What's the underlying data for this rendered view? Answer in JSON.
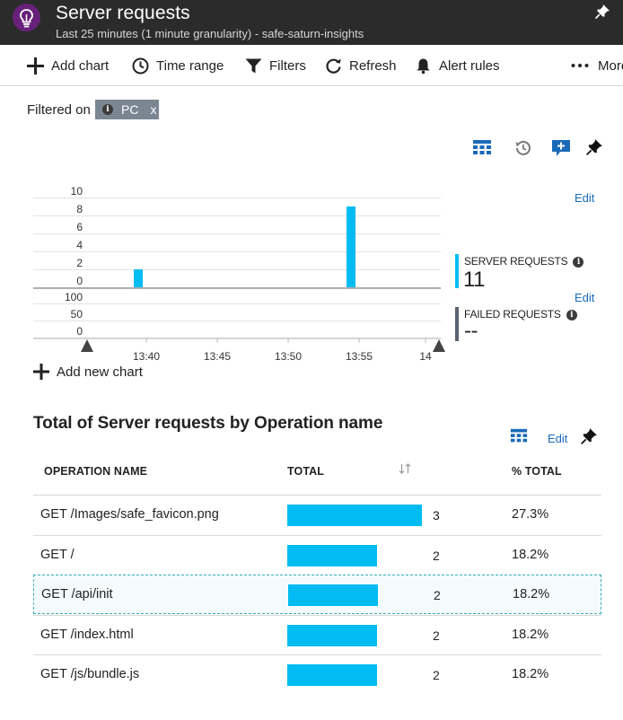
{
  "header": {
    "title": "Server requests",
    "subtitle": "Last 25 minutes (1 minute granularity) - safe-saturn-insights"
  },
  "toolbar": {
    "add_chart": "Add chart",
    "time_range": "Time range",
    "filters": "Filters",
    "refresh": "Refresh",
    "alert_rules": "Alert rules",
    "more": "More"
  },
  "filter": {
    "label": "Filtered on",
    "chip": "PC",
    "remove": "x"
  },
  "chart": {
    "edit_label": "Edit",
    "x_ticks": [
      "13:40",
      "13:45",
      "13:50",
      "13:55",
      "14"
    ],
    "top_y_ticks": [
      "10",
      "8",
      "6",
      "4",
      "2",
      "0"
    ],
    "bottom_y_ticks": [
      "100",
      "50",
      "0"
    ],
    "add_new_chart": "Add new chart",
    "metrics": [
      {
        "name": "SERVER REQUESTS",
        "value": "11",
        "color": "#00bcf2"
      },
      {
        "name": "FAILED REQUESTS",
        "value": "--",
        "color": "#5a6470"
      }
    ]
  },
  "chart_data": {
    "type": "bar",
    "x": [
      "13:40",
      "13:55"
    ],
    "values": [
      2,
      9
    ],
    "ylim": [
      0,
      10
    ],
    "xlabel": "",
    "ylabel": "",
    "grid": true
  },
  "table": {
    "title": "Total of Server requests by Operation name",
    "edit_label": "Edit",
    "columns": [
      "OPERATION NAME",
      "TOTAL",
      "% TOTAL"
    ],
    "max_total": 3,
    "rows": [
      {
        "operation": "GET /Images/safe_favicon.png",
        "total": "3",
        "pct": "27.3%"
      },
      {
        "operation": "GET /",
        "total": "2",
        "pct": "18.2%"
      },
      {
        "operation": "GET /api/init",
        "total": "2",
        "pct": "18.2%"
      },
      {
        "operation": "GET /index.html",
        "total": "2",
        "pct": "18.2%"
      },
      {
        "operation": "GET /js/bundle.js",
        "total": "2",
        "pct": "18.2%"
      }
    ]
  },
  "colors": {
    "accent": "#00bcf2",
    "link": "#1a6ab8",
    "header_bg": "#2b2b2b",
    "app_icon": "#68217a"
  }
}
